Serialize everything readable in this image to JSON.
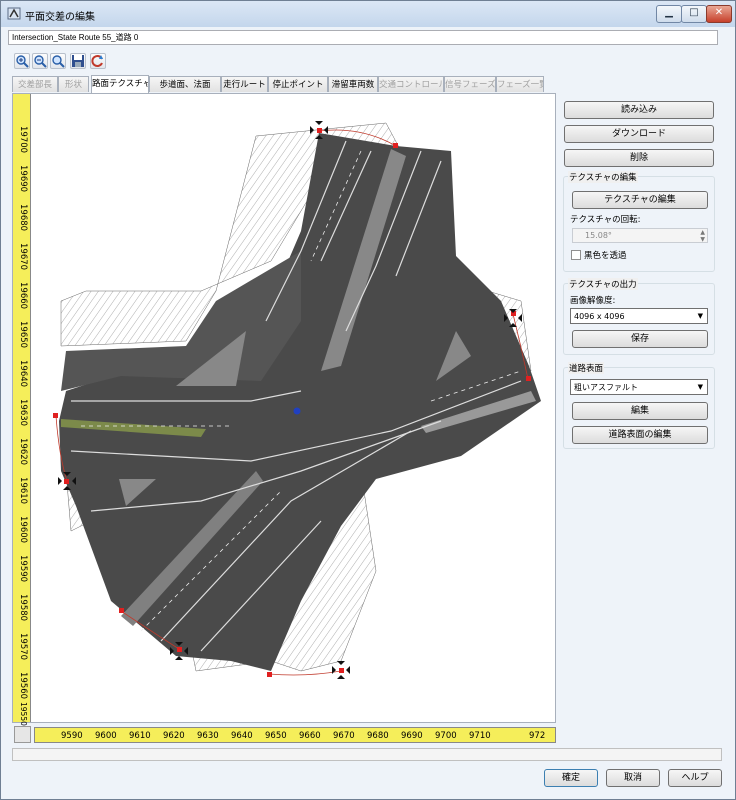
{
  "window": {
    "title": "平面交差の編集"
  },
  "name_field": {
    "value": "Intersection_State Route 55_道路 0"
  },
  "toolbar": {
    "icons": [
      "zoom-in-icon",
      "zoom-out-icon",
      "zoom-fit-icon",
      "save-icon",
      "refresh-icon"
    ]
  },
  "tabs": [
    {
      "label": "交差部長",
      "state": "disabled"
    },
    {
      "label": "形状",
      "state": "disabled"
    },
    {
      "label": "路面テクスチャ",
      "state": "active"
    },
    {
      "label": "歩道面、法面",
      "state": "normal"
    },
    {
      "label": "走行ルート",
      "state": "normal"
    },
    {
      "label": "停止ポイント",
      "state": "normal"
    },
    {
      "label": "滞留車両数",
      "state": "normal"
    },
    {
      "label": "交通コントロール",
      "state": "disabled"
    },
    {
      "label": "信号フェーズ",
      "state": "disabled"
    },
    {
      "label": "フェーズ一覧",
      "state": "disabled"
    }
  ],
  "vruler": {
    "labels": [
      "19700",
      "19690",
      "19680",
      "19670",
      "19660",
      "19650",
      "19640",
      "19630",
      "19620",
      "19610",
      "19600",
      "19590",
      "19580",
      "19570",
      "19560",
      "19550"
    ]
  },
  "hruler": {
    "labels": [
      "9590",
      "9600",
      "9610",
      "9620",
      "9630",
      "9640",
      "9650",
      "9660",
      "9670",
      "9680",
      "9690",
      "9700",
      "9710",
      "972"
    ]
  },
  "panel": {
    "load_button": "読み込み",
    "download_button": "ダウンロード",
    "delete_button": "削除",
    "texture_edit_group": "テクスチャの編集",
    "texture_edit_button": "テクスチャの編集",
    "rotation_label": "テクスチャの回転:",
    "rotation_value": "15.08°",
    "black_transparent_label": "黒色を透過",
    "texture_output_group": "テクスチャの出力",
    "resolution_label": "画像解像度:",
    "resolution_value": "4096 x 4096",
    "save_button": "保存",
    "road_surface_group": "道路表面",
    "surface_value": "粗いアスファルト",
    "edit_button": "編集",
    "surface_edit_button": "道路表面の編集"
  },
  "footer": {
    "ok": "確定",
    "cancel": "取消",
    "help": "ヘルプ"
  }
}
